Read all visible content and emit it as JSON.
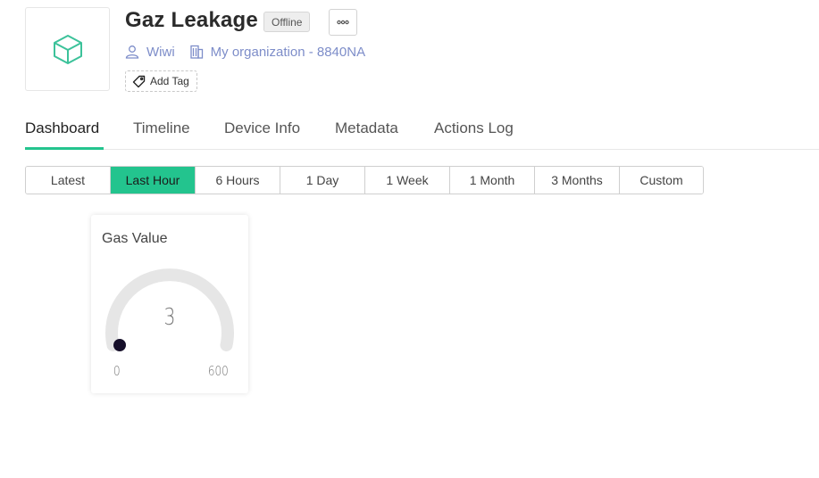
{
  "device": {
    "title": "Gaz Leakage",
    "status": "Offline",
    "owner": "Wiwi",
    "organization": "My organization - 8840NA",
    "add_tag_label": "Add Tag",
    "icon": "cube-icon",
    "accent_color": "#23c48e"
  },
  "tabs": [
    {
      "label": "Dashboard",
      "active": true
    },
    {
      "label": "Timeline"
    },
    {
      "label": "Device Info"
    },
    {
      "label": "Metadata"
    },
    {
      "label": "Actions Log"
    }
  ],
  "time_ranges": {
    "selected": "Last Hour",
    "options": [
      "Latest",
      "Last Hour",
      "6 Hours",
      "1 Day",
      "1 Week",
      "1 Month",
      "3 Months",
      "Custom"
    ]
  },
  "widget": {
    "title": "Gas Value",
    "value": "3",
    "min": "0",
    "max": "600"
  }
}
